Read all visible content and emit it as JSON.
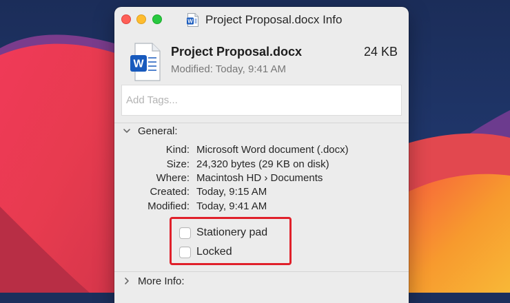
{
  "window": {
    "title": "Project Proposal.docx Info"
  },
  "file": {
    "name": "Project Proposal.docx",
    "size": "24 KB",
    "modified": "Modified: Today, 9:41 AM",
    "icon": "word-document-icon",
    "icon_letter": "W"
  },
  "tags": {
    "placeholder": "Add Tags...",
    "value": ""
  },
  "general": {
    "heading": "General:",
    "rows": [
      {
        "label": "Kind:",
        "value": "Microsoft Word document (.docx)"
      },
      {
        "label": "Size:",
        "value": "24,320 bytes (29 KB on disk)"
      },
      {
        "label": "Where:",
        "value": "Macintosh HD › Documents"
      },
      {
        "label": "Created:",
        "value": "Today, 9:15 AM"
      },
      {
        "label": "Modified:",
        "value": "Today, 9:41 AM"
      }
    ],
    "checkboxes": [
      {
        "label": "Stationery pad",
        "checked": false
      },
      {
        "label": "Locked",
        "checked": false
      }
    ]
  },
  "more_info": {
    "heading": "More Info:"
  },
  "colors": {
    "word_blue": "#185abd",
    "highlight_red": "#e0202a",
    "traffic_close": "#fe5f57",
    "traffic_minimize": "#febc2e",
    "traffic_zoom": "#28c840"
  }
}
